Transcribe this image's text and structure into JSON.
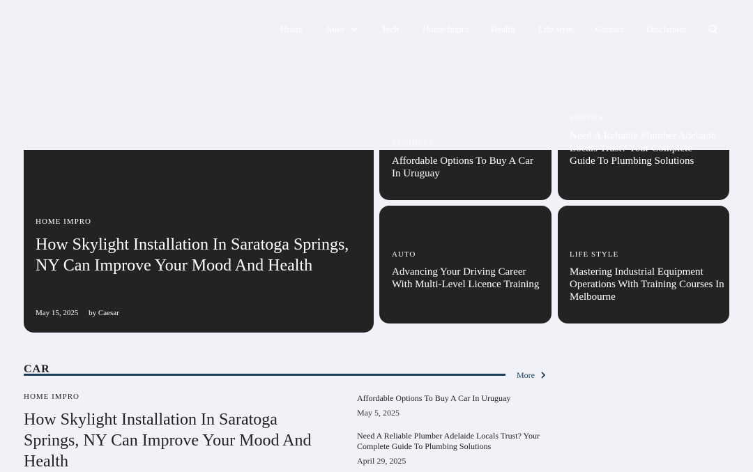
{
  "nav": {
    "items": [
      {
        "label": "Home"
      },
      {
        "label": "Auto"
      },
      {
        "label": "Tech"
      },
      {
        "label": "Home Impro"
      },
      {
        "label": "Health"
      },
      {
        "label": "Life style"
      },
      {
        "label": "Contact"
      },
      {
        "label": "Disclaimer"
      }
    ]
  },
  "hero": {
    "main": {
      "category": "HOME IMPRO",
      "title": "How Skylight Installation In Saratoga Springs, NY Can Improve Your Mood And Health",
      "date": "May 15, 2025",
      "author": "by Caesar"
    },
    "top_left": {
      "category": "BUSINESS",
      "title": "Affordable Options To Buy A Car In Uruguay"
    },
    "top_right": {
      "category": "SERVICE",
      "title": "Need A Reliable Plumber Adelaide Locals Trust? Your Complete Guide To Plumbing Solutions"
    },
    "bottom_left": {
      "category": "AUTO",
      "title": "Advancing Your Driving Career With Multi-Level Licence Training"
    },
    "bottom_right": {
      "category": "LIFE STYLE",
      "title": "Mastering Industrial Equipment Operations With Training Courses In Melbourne"
    }
  },
  "section": {
    "title": "CAR",
    "more_label": "More",
    "featured": {
      "category": "HOME IMPRO",
      "title": "How Skylight Installation In Saratoga Springs, NY Can Improve Your Mood And Health"
    },
    "list": [
      {
        "title": "Affordable Options To Buy A Car In Uruguay",
        "date": "May 5, 2025"
      },
      {
        "title": "Need A Reliable Plumber Adelaide Locals Trust? Your Complete Guide To Plumbing Solutions",
        "date": "April 29, 2025"
      }
    ]
  },
  "colors": {
    "background": "#f1f2f7",
    "card": "#232323",
    "accent": "#1b3d5c"
  }
}
